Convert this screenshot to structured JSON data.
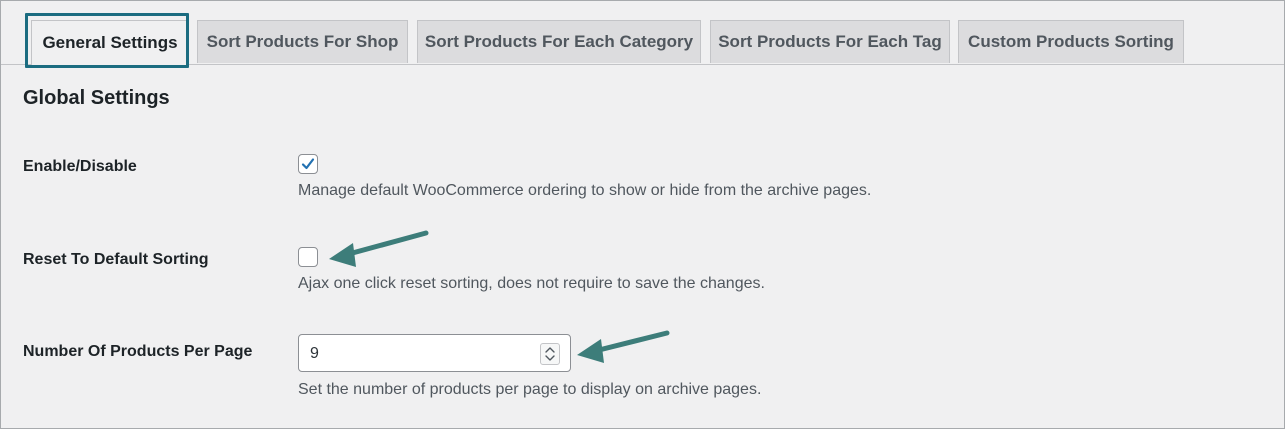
{
  "tabs": [
    {
      "label": "General Settings",
      "active": true
    },
    {
      "label": "Sort Products For Shop"
    },
    {
      "label": "Sort Products For Each Category"
    },
    {
      "label": "Sort Products For Each Tag"
    },
    {
      "label": "Custom Products Sorting"
    }
  ],
  "section_title": "Global Settings",
  "settings": {
    "enable": {
      "label": "Enable/Disable",
      "checked": true,
      "description": "Manage default WooCommerce ordering to show or hide from the archive pages."
    },
    "reset": {
      "label": "Reset To Default Sorting",
      "checked": false,
      "description": "Ajax one click reset sorting, does not require to save the changes."
    },
    "per_page": {
      "label": "Number Of Products Per Page",
      "value": "9",
      "description": "Set the number of products per page to display on archive pages."
    }
  },
  "colors": {
    "highlight": "#1b6c80",
    "annotation_arrow": "#3d7d7a",
    "checkbox_check": "#2271b1"
  },
  "icons": {
    "checkmark": "checkmark-icon",
    "spinner": "chevron-up-down-icon",
    "arrow": "annotation-arrow-icon"
  }
}
